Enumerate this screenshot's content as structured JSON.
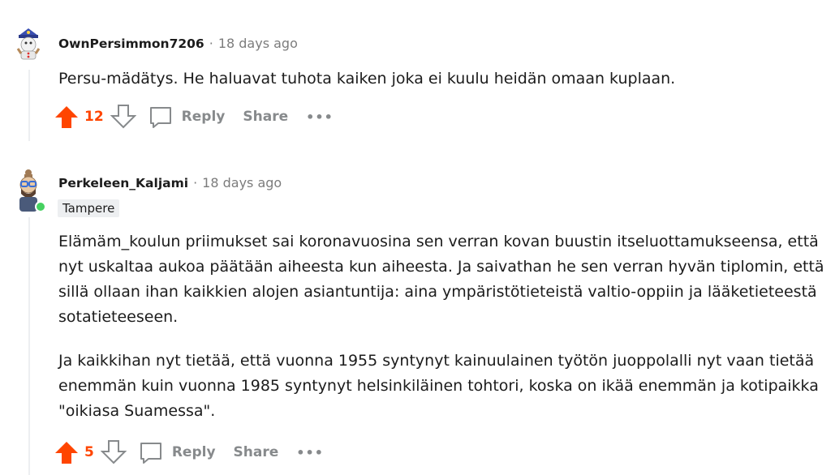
{
  "comments": [
    {
      "author": "OwnPersimmon7206",
      "separator": "·",
      "time": "18 days ago",
      "paragraphs": [
        "Persu-mädätys. He haluavat tuhota kaiken joka ei kuulu heidän omaan kuplaan."
      ],
      "score": "12",
      "reply_label": "Reply",
      "share_label": "Share",
      "more_label": "•••"
    },
    {
      "author": "Perkeleen_Kaljami",
      "separator": "·",
      "time": "18 days ago",
      "flair": "Tampere",
      "paragraphs": [
        "Elämäm_koulun priimukset sai koronavuosina sen verran kovan buustin itseluottamukseensa, että nyt uskaltaa aukoa päätään aiheesta kun aiheesta. Ja saivathan he sen verran hyvän tiplomin, että sillä ollaan ihan kaikkien alojen asiantuntija: aina ympäristötieteistä valtio-oppiin ja lääketieteestä sotatieteeseen.",
        "Ja kaikkihan nyt tietää, että vuonna 1955 syntynyt kainuulainen työtön juoppolalli nyt vaan tietää enemmän kuin vuonna 1985 syntynyt helsinkiläinen tohtori, koska on ikää enemmän ja kotipaikka \"oikiasa Suamessa\"."
      ],
      "score": "5",
      "reply_label": "Reply",
      "share_label": "Share",
      "more_label": "•••"
    }
  ],
  "colors": {
    "upvote": "#ff4500",
    "muted": "#878a8c",
    "online": "#46d160"
  }
}
